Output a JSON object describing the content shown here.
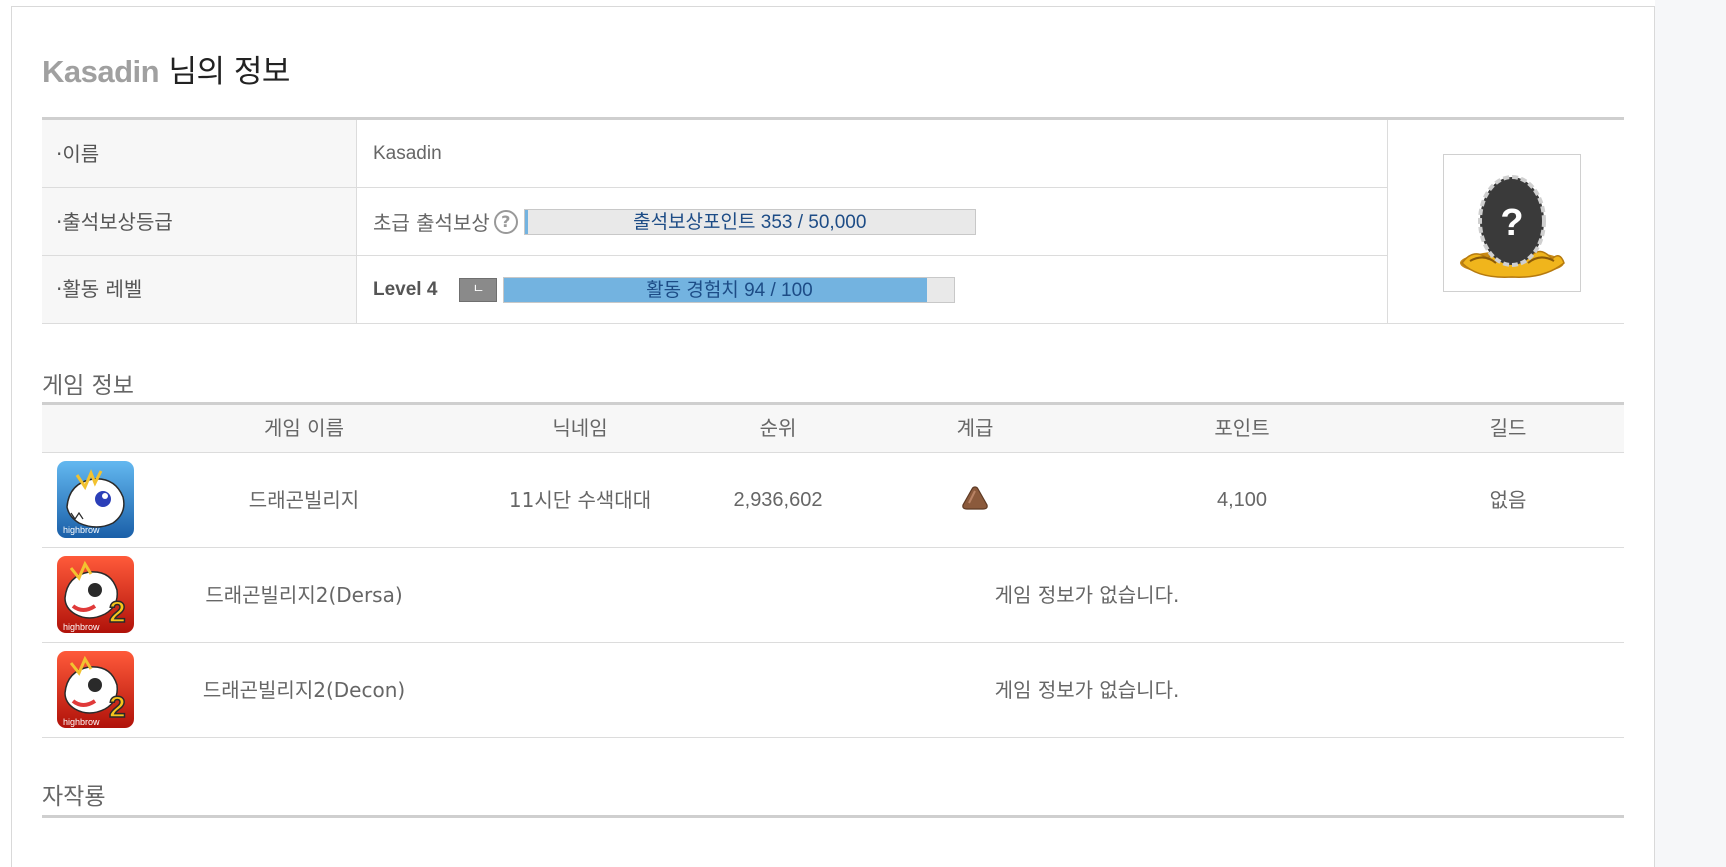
{
  "page": {
    "title_nick": "Kasadin",
    "title_suffix": " 님의 정보"
  },
  "profile": {
    "name_label": "·이름",
    "name_value": "Kasadin",
    "attendance_label": "·출석보상등급",
    "attendance_grade": "초급 출석보상",
    "attendance_help": "?",
    "attendance_bar_text": "출석보상포인트 353 / 50,000",
    "attendance_progress": 0.00706,
    "activity_label": "·활동 레벨",
    "activity_level": "Level 4",
    "activity_badge": "ㄴ",
    "activity_bar_text": "활동 경험치 94 / 100",
    "activity_progress": 0.94,
    "photo_placeholder": "?"
  },
  "game_section": {
    "title": "게임 정보",
    "headers": [
      "게임 이름",
      "닉네임",
      "순위",
      "계급",
      "포인트",
      "길드"
    ],
    "rows": [
      {
        "icon": "dragon-village-icon",
        "game": "드래곤빌리지",
        "nickname": "11시단 수색대대",
        "rank": "2,936,602",
        "grade_icon": "bronze-triangle-icon",
        "points": "4,100",
        "guild": "없음"
      },
      {
        "icon": "dragon-village-2-icon",
        "game": "드래곤빌리지2(Dersa)",
        "no_info": "게임 정보가 없습니다."
      },
      {
        "icon": "dragon-village-2-icon",
        "game": "드래곤빌리지2(Decon)",
        "no_info": "게임 정보가 없습니다."
      }
    ],
    "icon_caption": "highbrow",
    "icon_numeral": "2"
  },
  "works_section": {
    "title": "자작룡"
  },
  "colors": {
    "bar_fill": "#73b3e0",
    "bar_text": "#1d4c86",
    "grade_bronze": "#8b5a3c"
  }
}
